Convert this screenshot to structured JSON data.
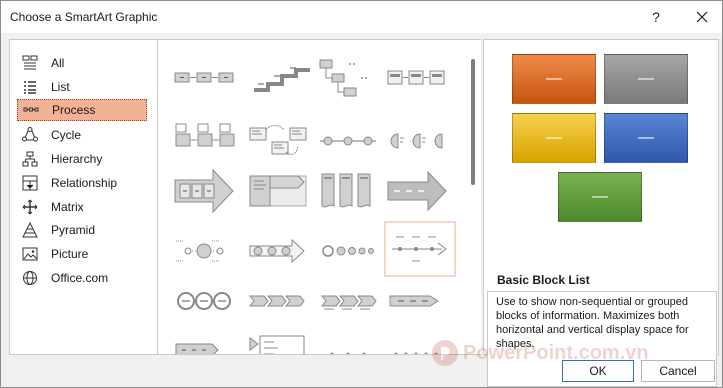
{
  "window": {
    "title": "Choose a SmartArt Graphic",
    "help_glyph": "?",
    "close_icon": "close-icon"
  },
  "categories": [
    {
      "label": "All",
      "icon": "all-icon"
    },
    {
      "label": "List",
      "icon": "list-icon"
    },
    {
      "label": "Process",
      "icon": "process-icon",
      "selected": true
    },
    {
      "label": "Cycle",
      "icon": "cycle-icon"
    },
    {
      "label": "Hierarchy",
      "icon": "hierarchy-icon"
    },
    {
      "label": "Relationship",
      "icon": "relationship-icon"
    },
    {
      "label": "Matrix",
      "icon": "matrix-icon"
    },
    {
      "label": "Pyramid",
      "icon": "pyramid-icon"
    },
    {
      "label": "Picture",
      "icon": "picture-icon"
    },
    {
      "label": "Office.com",
      "icon": "globe-icon"
    }
  ],
  "preview": {
    "box_text": "—",
    "name": "Basic Block List",
    "description": "Use to show non-sequential or grouped blocks of information. Maximizes both horizontal and vertical display space for shapes.",
    "colors": [
      "#e0681e",
      "#8c8c8c",
      "#f1b90a",
      "#3d6bbf",
      "#5e9c3a"
    ]
  },
  "buttons": {
    "ok": "OK",
    "cancel": "Cancel"
  },
  "watermark": {
    "text": "PowerPoint.com.vn"
  },
  "accent": "#f3b195"
}
